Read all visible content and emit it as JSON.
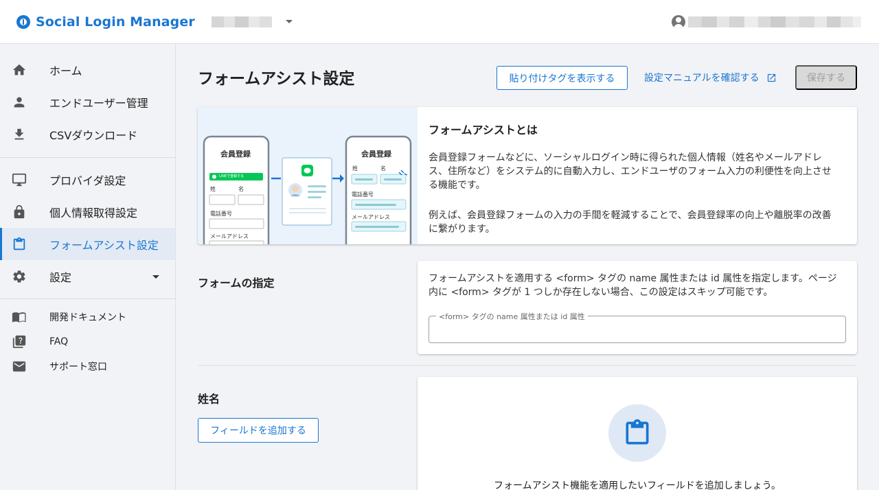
{
  "header": {
    "app_name": "Social Login Manager"
  },
  "sidebar": {
    "items": [
      {
        "label": "ホーム",
        "icon": "home-icon"
      },
      {
        "label": "エンドユーザー管理",
        "icon": "person-icon"
      },
      {
        "label": "CSVダウンロード",
        "icon": "download-icon"
      },
      {
        "label": "プロバイダ設定",
        "icon": "monitor-icon"
      },
      {
        "label": "個人情報取得設定",
        "icon": "lock-icon"
      },
      {
        "label": "フォームアシスト設定",
        "icon": "clipboard-icon",
        "active": true
      },
      {
        "label": "設定",
        "icon": "gear-icon"
      },
      {
        "label": "開発ドキュメント",
        "icon": "book-icon"
      },
      {
        "label": "FAQ",
        "icon": "help-icon"
      },
      {
        "label": "サポート窓口",
        "icon": "mail-icon"
      }
    ]
  },
  "main": {
    "title": "フォームアシスト設定",
    "show_tag_button": "貼り付けタグを表示する",
    "manual_link": "設定マニュアルを確認する",
    "save_button": "保存する",
    "intro": {
      "title": "フォームアシストとは",
      "p1": "会員登録フォームなどに、ソーシャルログイン時に得られた個人情報（姓名やメールアドレス、住所など）をシステム的に自動入力し、エンドユーザのフォーム入力の利便性を向上させる機能です。",
      "p2": "例えば、会員登録フォームの入力の手間を軽減することで、会員登録率の向上や離脱率の改善に繋がります。",
      "illustration": {
        "left_title": "会員登録",
        "line_button": "LINEで登録する",
        "last_name": "姓",
        "first_name": "名",
        "phone": "電話番号",
        "email": "メールアドレス",
        "right_title": "会員登録"
      }
    },
    "form_section": {
      "label": "フォームの指定",
      "description": "フォームアシストを適用する <form> タグの name 属性または id 属性を指定します。ページ内に <form> タグが 1 つしか存在しない場合、この設定はスキップ可能です。",
      "field_label": "<form> タグの name 属性または id 属性",
      "field_value": ""
    },
    "name_section": {
      "label": "姓名",
      "add_button": "フィールドを追加する",
      "empty_text": "フォームアシスト機能を適用したいフィールドを追加しましょう。"
    }
  },
  "colors": {
    "accent": "#1976d2",
    "line_green": "#06c755"
  }
}
